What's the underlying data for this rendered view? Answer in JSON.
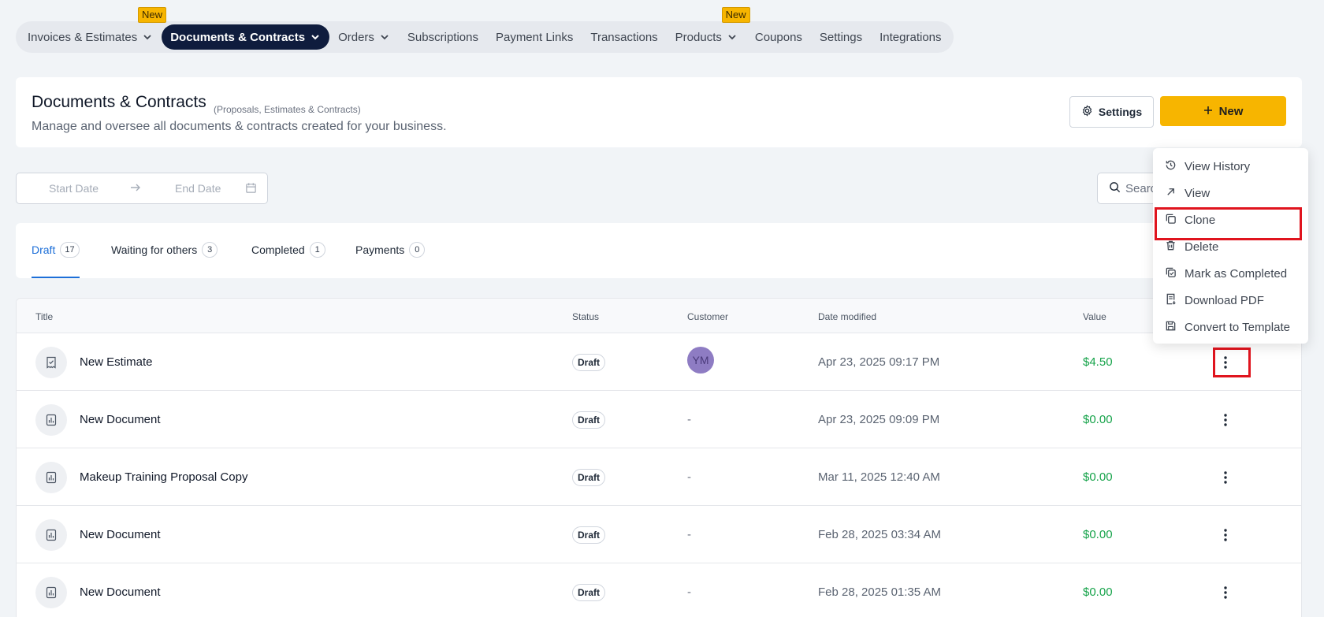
{
  "topnav": {
    "items": [
      {
        "label": "Invoices & Estimates",
        "dropdown": true,
        "badge": "New"
      },
      {
        "label": "Documents & Contracts",
        "dropdown": true,
        "active": true
      },
      {
        "label": "Orders",
        "dropdown": true
      },
      {
        "label": "Subscriptions"
      },
      {
        "label": "Payment Links"
      },
      {
        "label": "Transactions"
      },
      {
        "label": "Products",
        "dropdown": true,
        "badge": "New"
      },
      {
        "label": "Coupons"
      },
      {
        "label": "Settings"
      },
      {
        "label": "Integrations"
      }
    ]
  },
  "header": {
    "title": "Documents & Contracts",
    "subtitle": "(Proposals, Estimates & Contracts)",
    "description": "Manage and oversee all documents & contracts created for your business.",
    "settings_label": "Settings",
    "new_label": "New"
  },
  "filters": {
    "start_placeholder": "Start Date",
    "end_placeholder": "End Date",
    "search_placeholder": "Search"
  },
  "tabs": [
    {
      "label": "Draft",
      "count": "17",
      "active": true
    },
    {
      "label": "Waiting for others",
      "count": "3"
    },
    {
      "label": "Completed",
      "count": "1"
    },
    {
      "label": "Payments",
      "count": "0"
    }
  ],
  "table": {
    "headers": {
      "title": "Title",
      "status": "Status",
      "customer": "Customer",
      "date": "Date modified",
      "value": "Value"
    },
    "rows": [
      {
        "title": "New Estimate",
        "status": "Draft",
        "customer": "YM",
        "customer_is_avatar": true,
        "date": "Apr 23, 2025 09:17 PM",
        "value": "$4.50",
        "icon": "estimate-icon"
      },
      {
        "title": "New Document",
        "status": "Draft",
        "customer": "-",
        "date": "Apr 23, 2025 09:09 PM",
        "value": "$0.00",
        "icon": "document-chart-icon"
      },
      {
        "title": "Makeup Training Proposal Copy",
        "status": "Draft",
        "customer": "-",
        "date": "Mar 11, 2025 12:40 AM",
        "value": "$0.00",
        "icon": "document-chart-icon"
      },
      {
        "title": "New Document",
        "status": "Draft",
        "customer": "-",
        "date": "Feb 28, 2025 03:34 AM",
        "value": "$0.00",
        "icon": "document-chart-icon"
      },
      {
        "title": "New Document",
        "status": "Draft",
        "customer": "-",
        "date": "Feb 28, 2025 01:35 AM",
        "value": "$0.00",
        "icon": "document-chart-icon"
      }
    ]
  },
  "menu": {
    "items": [
      {
        "label": "View History",
        "icon": "history-icon"
      },
      {
        "label": "View",
        "icon": "arrow-up-right-icon"
      },
      {
        "label": "Clone",
        "icon": "copy-icon",
        "highlight": true
      },
      {
        "label": "Delete",
        "icon": "trash-icon"
      },
      {
        "label": "Mark as Completed",
        "icon": "check-copy-icon"
      },
      {
        "label": "Download PDF",
        "icon": "download-file-icon"
      },
      {
        "label": "Convert to Template",
        "icon": "save-icon"
      }
    ]
  },
  "colors": {
    "accent": "#f7b500",
    "active_nav": "#0f1c3d",
    "tab_active": "#1d6fd8",
    "value_green": "#16a34a",
    "highlight_red": "#e0141e"
  }
}
